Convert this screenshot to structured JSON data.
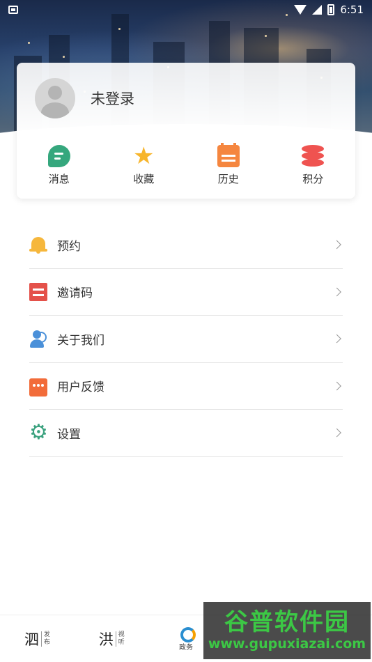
{
  "status_bar": {
    "time": "6:51"
  },
  "profile": {
    "username": "未登录"
  },
  "quick_actions": [
    {
      "label": "消息",
      "icon": "message-icon",
      "color": "#35a77d"
    },
    {
      "label": "收藏",
      "icon": "star-icon",
      "color": "#f7b52b"
    },
    {
      "label": "历史",
      "icon": "calendar-icon",
      "color": "#f5863f"
    },
    {
      "label": "积分",
      "icon": "coins-icon",
      "color": "#ef5350"
    }
  ],
  "menu": [
    {
      "label": "预约",
      "icon": "bell-icon"
    },
    {
      "label": "邀请码",
      "icon": "invite-code-icon"
    },
    {
      "label": "关于我们",
      "icon": "user-info-icon"
    },
    {
      "label": "用户反馈",
      "icon": "feedback-icon"
    },
    {
      "label": "设置",
      "icon": "gear-icon"
    }
  ],
  "tabs": [
    {
      "big": "泗",
      "small_top": "发",
      "small_bottom": "布"
    },
    {
      "big": "洪",
      "small_top": "视",
      "small_bottom": "听"
    },
    {
      "label": "政务"
    }
  ],
  "watermark": {
    "title": "谷普软件园",
    "url": "www.gupuxiazai.com"
  }
}
